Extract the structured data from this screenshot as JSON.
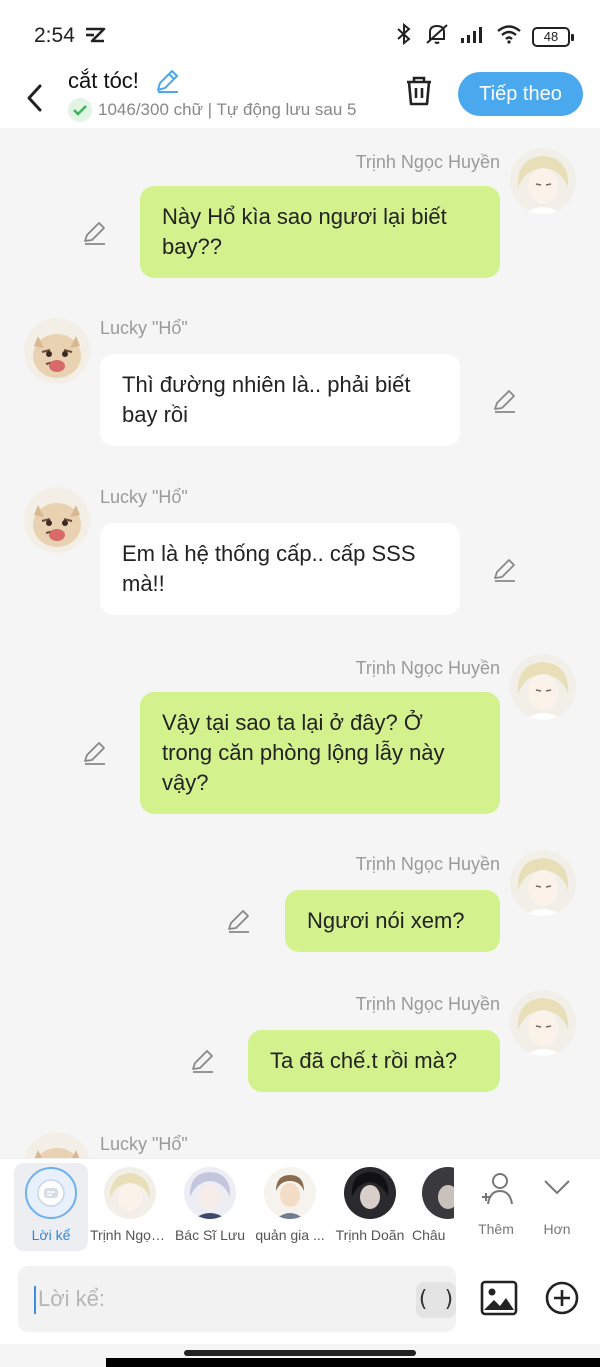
{
  "status": {
    "time": "2:54",
    "battery": "48",
    "icons": [
      "app-ic-icon",
      "bluetooth-icon",
      "silent-bell-icon",
      "signal-icon",
      "wifi-icon",
      "battery-icon"
    ]
  },
  "header": {
    "title": "cắt tóc!",
    "subtitle": "1046/300 chữ | Tự động lưu sau 5",
    "next_label": "Tiếp theo"
  },
  "messages": [
    {
      "side": "me",
      "name": "Trịnh Ngọc Huyền",
      "text": "Này Hổ kìa sao ngươi lại biết bay??"
    },
    {
      "side": "other",
      "name": "Lucky \"Hổ\"",
      "text": "Thì đường nhiên là.. phải biết bay rồi"
    },
    {
      "side": "other",
      "name": "Lucky \"Hổ\"",
      "text": "Em là hệ thống cấp.. cấp SSS mà!!"
    },
    {
      "side": "me",
      "name": "Trịnh Ngọc Huyền",
      "text": "Vậy tại sao ta lại ở đây? Ở trong căn phòng lộng lẫy này vậy?"
    },
    {
      "side": "me",
      "name": "Trịnh Ngọc Huyền",
      "text": "Ngươi nói xem?"
    },
    {
      "side": "me",
      "name": "Trịnh Ngọc Huyền",
      "text": "Ta đã chế.t rồi mà?"
    },
    {
      "side": "other",
      "name": "Lucky \"Hổ\"",
      "text": ""
    }
  ],
  "characters": [
    {
      "label": "Lời kể"
    },
    {
      "label": "Trịnh Ngọc Huyền"
    },
    {
      "label": "Bác Sĩ Lưu"
    },
    {
      "label": "quản gia ..."
    },
    {
      "label": "Trịnh Doãn"
    },
    {
      "label": "Châu"
    }
  ],
  "actions": {
    "add_label": "Thêm",
    "more_label": "Hơn"
  },
  "composer": {
    "placeholder": "Lời kể:",
    "paren_label": "( )"
  },
  "colors": {
    "accent": "#4aa8ef",
    "my_bubble": "#d3f28e",
    "other_bubble": "#ffffff",
    "background": "#f5f5f5"
  }
}
